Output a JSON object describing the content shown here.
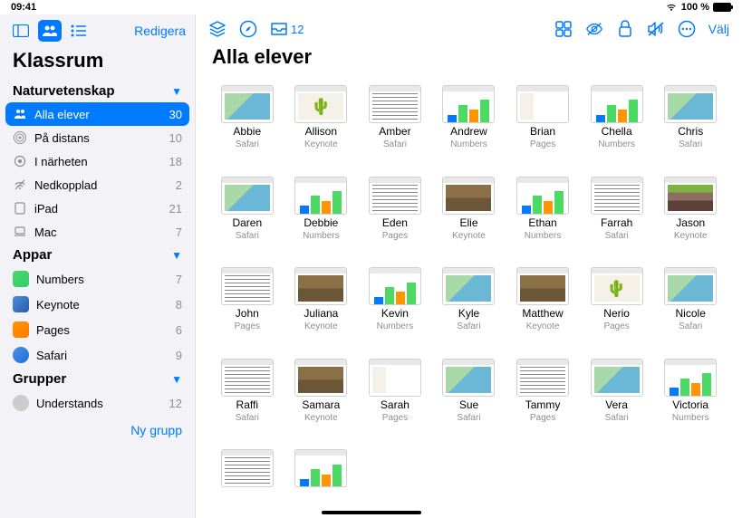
{
  "statusbar": {
    "time": "09:41",
    "battery": "100 %"
  },
  "sidebar": {
    "edit": "Redigera",
    "title": "Klassrum",
    "sections": [
      {
        "header": "Naturvetenskap",
        "items": [
          {
            "icon": "people",
            "label": "Alla elever",
            "count": "30",
            "selected": true
          },
          {
            "icon": "distance",
            "label": "På distans",
            "count": "10"
          },
          {
            "icon": "nearby",
            "label": "I närheten",
            "count": "18"
          },
          {
            "icon": "offline",
            "label": "Nedkopplad",
            "count": "2"
          },
          {
            "icon": "ipad",
            "label": "iPad",
            "count": "21"
          },
          {
            "icon": "mac",
            "label": "Mac",
            "count": "7"
          }
        ]
      },
      {
        "header": "Appar",
        "items": [
          {
            "icon": "numbers",
            "label": "Numbers",
            "count": "7"
          },
          {
            "icon": "keynote",
            "label": "Keynote",
            "count": "8"
          },
          {
            "icon": "pages",
            "label": "Pages",
            "count": "6"
          },
          {
            "icon": "safari",
            "label": "Safari",
            "count": "9"
          }
        ]
      },
      {
        "header": "Grupper",
        "items": [
          {
            "icon": "avatar",
            "label": "Understands",
            "count": "12"
          }
        ]
      }
    ],
    "newGroup": "Ny grupp"
  },
  "toolbar": {
    "inboxCount": "12",
    "select": "Välj"
  },
  "main": {
    "title": "Alla elever"
  },
  "students": [
    {
      "name": "Abbie",
      "app": "Safari",
      "t": "map"
    },
    {
      "name": "Allison",
      "app": "Keynote",
      "t": "plant"
    },
    {
      "name": "Amber",
      "app": "Safari",
      "t": "doc"
    },
    {
      "name": "Andrew",
      "app": "Numbers",
      "t": "chart"
    },
    {
      "name": "Brian",
      "app": "Pages",
      "t": "pages"
    },
    {
      "name": "Chella",
      "app": "Numbers",
      "t": "chart"
    },
    {
      "name": "Chris",
      "app": "Safari",
      "t": "map"
    },
    {
      "name": "Daren",
      "app": "Safari",
      "t": "map"
    },
    {
      "name": "Debbie",
      "app": "Numbers",
      "t": "chart"
    },
    {
      "name": "Eden",
      "app": "Pages",
      "t": "doc"
    },
    {
      "name": "Elie",
      "app": "Keynote",
      "t": "earth"
    },
    {
      "name": "Ethan",
      "app": "Numbers",
      "t": "chart"
    },
    {
      "name": "Farrah",
      "app": "Safari",
      "t": "doc"
    },
    {
      "name": "Jason",
      "app": "Keynote",
      "t": "soil"
    },
    {
      "name": "John",
      "app": "Pages",
      "t": "doc"
    },
    {
      "name": "Juliana",
      "app": "Keynote",
      "t": "earth"
    },
    {
      "name": "Kevin",
      "app": "Numbers",
      "t": "chart"
    },
    {
      "name": "Kyle",
      "app": "Safari",
      "t": "map"
    },
    {
      "name": "Matthew",
      "app": "Keynote",
      "t": "earth"
    },
    {
      "name": "Nerio",
      "app": "Pages",
      "t": "plant"
    },
    {
      "name": "Nicole",
      "app": "Safari",
      "t": "map"
    },
    {
      "name": "Raffi",
      "app": "Safari",
      "t": "doc"
    },
    {
      "name": "Samara",
      "app": "Keynote",
      "t": "earth"
    },
    {
      "name": "Sarah",
      "app": "Pages",
      "t": "pages"
    },
    {
      "name": "Sue",
      "app": "Safari",
      "t": "map"
    },
    {
      "name": "Tammy",
      "app": "Pages",
      "t": "doc"
    },
    {
      "name": "Vera",
      "app": "Safari",
      "t": "map"
    },
    {
      "name": "Victoria",
      "app": "Numbers",
      "t": "chart"
    },
    {
      "name": "",
      "app": "",
      "t": "doc"
    },
    {
      "name": "",
      "app": "",
      "t": "chart"
    }
  ]
}
